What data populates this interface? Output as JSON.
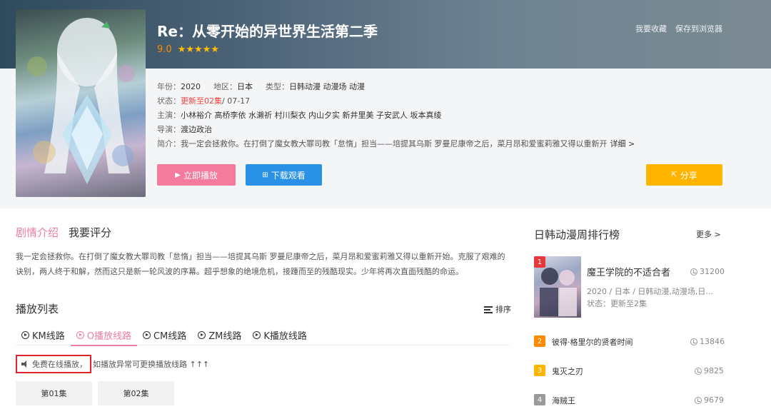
{
  "header": {
    "title": "Re：从零开始的异世界生活第二季",
    "score": "9.0",
    "stars": "★★★★★",
    "favorite_label": "我要收藏",
    "save_label": "保存到浏览器"
  },
  "info": {
    "year_key": "年份：",
    "year": "2020",
    "region_key": "地区：",
    "region": "日本",
    "type_key": "类型：",
    "type": "日韩动漫 动漫场 动漫",
    "status_key": "状态：",
    "status": "更新至02集",
    "status_date": " / 07-17",
    "cast_key": "主演：",
    "cast": "小林裕介 高桥李依 水濑祈 村川梨衣 内山夕实 新井里美 子安武人 坂本真绫",
    "director_key": "导演：",
    "director": "渡边政治",
    "intro_key": "简介：",
    "intro": "我一定会拯救你。在打倒了魔女教大罪司教「怠惰」担当——培提其乌斯 罗曼尼康帝之后，菜月昂和爱蜜莉雅又得以重新开",
    "detail_label": "详细 >"
  },
  "buttons": {
    "play_label": "立即播放",
    "play_icon": "▶",
    "download_label": "下载观看",
    "download_icon": "⊞",
    "share_label": "分享",
    "share_icon": "⇱"
  },
  "tabs": {
    "plot": "剧情介绍",
    "rate": "我要评分"
  },
  "synopsis": "我一定会拯救你。在打倒了魔女教大罪司教「怠惰」担当——培提其乌斯 罗曼尼康帝之后，菜月昂和爱蜜莉雅又得以重新开始。克服了艰难的诀别，两人终于和解，然而这只是新一轮风波的序幕。超乎想象的绝境危机，接踵而至的残酷现实。少年将再次直面残酷的命运。",
  "playlist": {
    "title": "播放列表",
    "sort_label": "排序",
    "lines": [
      "KM线路",
      "O播放线路",
      "CM线路",
      "ZM线路",
      "K播放线路"
    ],
    "notice_boxed": "免费在线播放，",
    "notice_rest": "如播放异常可更换播放线路 ↑↑↑",
    "episodes": [
      "第01集",
      "第02集"
    ]
  },
  "sidebar": {
    "title": "日韩动漫周排行榜",
    "more_label": "更多 >",
    "items": [
      {
        "rank": "1",
        "name": "魔王学院的不适合者",
        "hot": "31200",
        "sub": "2020 / 日本 / 日韩动漫,动漫场,日...",
        "status": "状态：更新至2集"
      },
      {
        "rank": "2",
        "name": "彼得·格里尔的贤者时间",
        "hot": "13846"
      },
      {
        "rank": "3",
        "name": "鬼灭之刃",
        "hot": "9825"
      },
      {
        "rank": "4",
        "name": "海贼王",
        "hot": "9679"
      }
    ]
  },
  "colors": {
    "accent_pink": "#ec7fa0",
    "play_button": "#f47a9e",
    "download_button": "#2a92e6",
    "share_button": "#ffb400",
    "status_red": "#f0443c",
    "notice_border": "#e0262c",
    "rank1": "#e8363a",
    "rank2": "#ff8a00",
    "rank3": "#ffb400",
    "rank4": "#9a9a9a"
  }
}
